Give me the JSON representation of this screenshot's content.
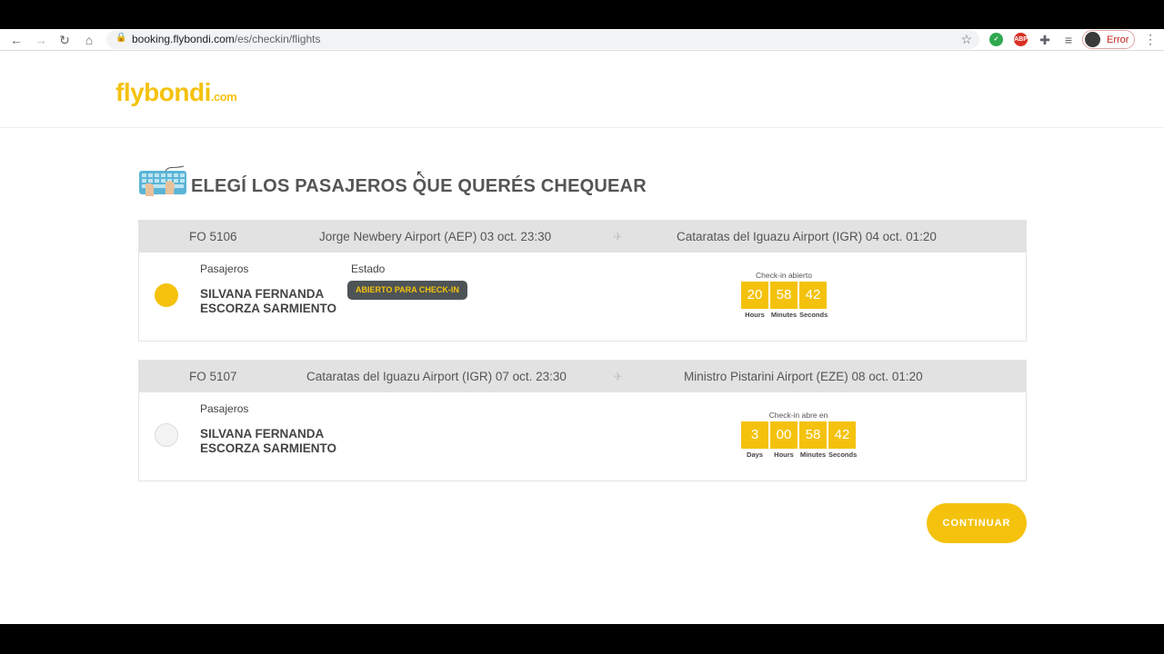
{
  "browser": {
    "url_domain": "booking.flybondi.com",
    "url_path": "/es/checkin/flights",
    "profile_label": "Error",
    "abp_label": "ABP"
  },
  "site": {
    "logo_main": "flybondi",
    "logo_suffix": ".com"
  },
  "page": {
    "heading": "ELEGÍ LOS PASAJEROS QUE QUERÉS CHEQUEAR",
    "continue_label": "CONTINUAR"
  },
  "flights": [
    {
      "number": "FO 5106",
      "origin": "Jorge Newbery Airport (AEP) 03 oct. 23:30",
      "destination": "Cataratas del Iguazu Airport (IGR) 04 oct. 01:20",
      "passengers_label": "Pasajeros",
      "passenger_name": "SILVANA FERNANDA ESCORZA SARMIENTO",
      "status_label": "Estado",
      "status": "ABIERTO PARA CHECK-IN",
      "selected": true,
      "timer_caption": "Check-in abierto",
      "timer": [
        {
          "value": "20",
          "unit": "Hours"
        },
        {
          "value": "58",
          "unit": "Minutes"
        },
        {
          "value": "42",
          "unit": "Seconds"
        }
      ]
    },
    {
      "number": "FO 5107",
      "origin": "Cataratas del Iguazu Airport (IGR) 07 oct. 23:30",
      "destination": "Ministro Pistarini Airport (EZE) 08 oct. 01:20",
      "passengers_label": "Pasajeros",
      "passenger_name": "SILVANA FERNANDA ESCORZA SARMIENTO",
      "selected": false,
      "timer_caption": "Check-in abre en",
      "timer": [
        {
          "value": "3",
          "unit": "Days"
        },
        {
          "value": "00",
          "unit": "Hours"
        },
        {
          "value": "58",
          "unit": "Minutes"
        },
        {
          "value": "42",
          "unit": "Seconds"
        }
      ]
    }
  ],
  "colors": {
    "brand_yellow": "#f4c20d",
    "status_bg": "#4e5455",
    "card_header": "#e2e2e2"
  }
}
